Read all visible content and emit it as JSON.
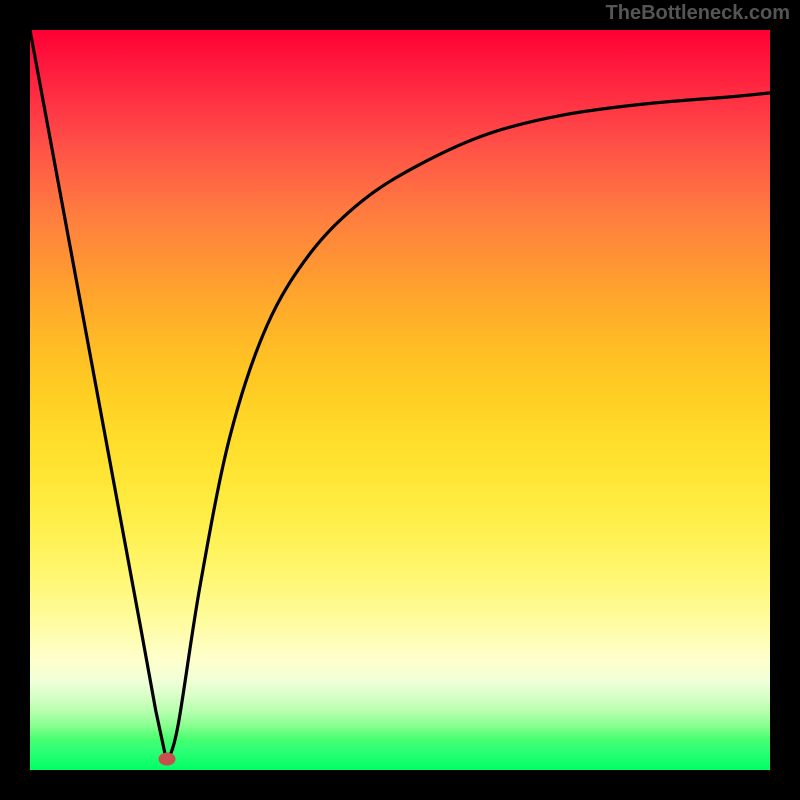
{
  "attribution": "TheBottleneck.com",
  "chart_data": {
    "type": "line",
    "title": "",
    "xlabel": "",
    "ylabel": "",
    "xlim": [
      0,
      100
    ],
    "ylim": [
      0,
      100
    ],
    "series": [
      {
        "name": "bottleneck-curve",
        "x": [
          0,
          5,
          10,
          15,
          17,
          18.5,
          20,
          23,
          27,
          32,
          38,
          45,
          53,
          62,
          72,
          83,
          95,
          100
        ],
        "y": [
          100,
          73,
          46,
          19,
          8,
          1,
          6,
          25,
          45,
          60,
          70,
          77,
          82,
          86,
          88.5,
          90,
          91,
          91.5
        ]
      }
    ],
    "marker": {
      "x": 18.5,
      "y": 1.5
    },
    "gradient_stops": [
      {
        "pos": 0,
        "color": "#ff0033"
      },
      {
        "pos": 50,
        "color": "#ffd024"
      },
      {
        "pos": 85,
        "color": "#ffffcc"
      },
      {
        "pos": 100,
        "color": "#00ff66"
      }
    ]
  }
}
